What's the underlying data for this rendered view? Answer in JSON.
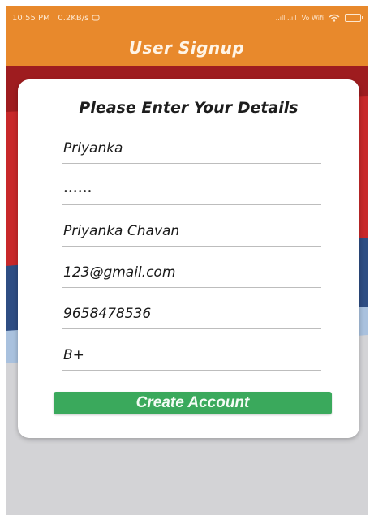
{
  "status_bar": {
    "time_speed": "10:55 PM | 0.2KB/s",
    "network": "..ıll ..ıll",
    "wifi_label": "Vo Wifi"
  },
  "app_bar": {
    "title": "User Signup"
  },
  "form": {
    "heading": "Please Enter Your Details",
    "username": "Priyanka",
    "password": "••••••",
    "full_name": "Priyanka Chavan",
    "email": "123@gmail.com",
    "phone": "9658478536",
    "blood_group": "B+",
    "submit_label": "Create Account"
  },
  "colors": {
    "accent": "#e8892c",
    "button": "#3aa95c",
    "bg_red": "#c8282a",
    "bg_blue": "#2e4d83"
  }
}
